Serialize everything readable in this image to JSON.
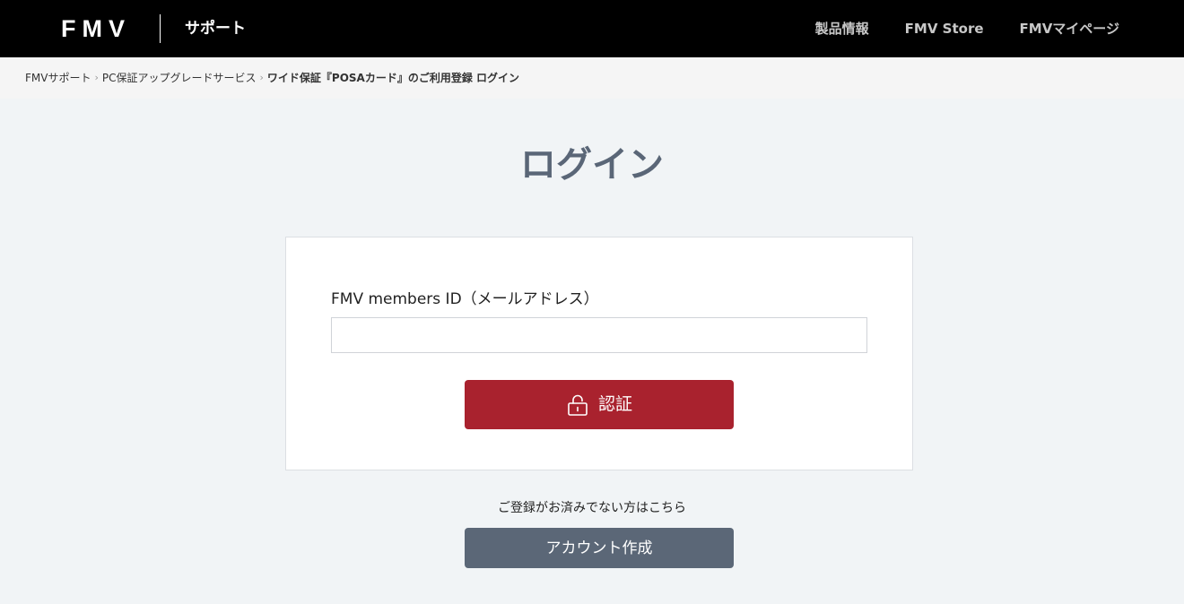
{
  "header": {
    "logo": "FMV",
    "site_label": "サポート",
    "nav": [
      {
        "label": "製品情報"
      },
      {
        "label": "FMV Store"
      },
      {
        "label": "FMVマイページ"
      }
    ]
  },
  "breadcrumb": {
    "items": [
      {
        "label": "FMVサポート"
      },
      {
        "label": "PC保証アップグレードサービス"
      },
      {
        "label": "ワイド保証『POSAカード』のご利用登録 ログイン"
      }
    ],
    "separator": "›"
  },
  "page": {
    "title": "ログイン"
  },
  "form": {
    "id_label": "FMV members ID（メールアドレス）",
    "id_value": "",
    "id_placeholder": "",
    "submit_label": "認証",
    "submit_icon": "unlock-icon"
  },
  "register": {
    "note": "ご登録がお済みでない方はこちら",
    "button_label": "アカウント作成"
  },
  "colors": {
    "header_bg": "#000000",
    "primary_button": "#a9222e",
    "secondary_button": "#5b6777",
    "title": "#5a6677",
    "page_bg": "#f1f4f6"
  }
}
